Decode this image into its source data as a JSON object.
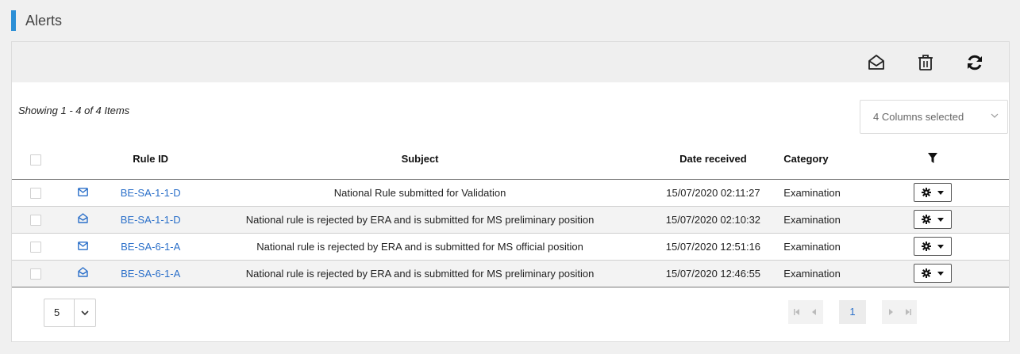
{
  "page": {
    "title": "Alerts"
  },
  "toolbar": {
    "buttons": [
      {
        "icon": "envelope-open-icon",
        "action": "mark-read"
      },
      {
        "icon": "trash-icon",
        "action": "delete"
      },
      {
        "icon": "refresh-icon",
        "action": "refresh"
      }
    ]
  },
  "summary": {
    "showing": "Showing 1 - 4 of 4 Items",
    "columns_selected": "4 Columns selected"
  },
  "table": {
    "headers": {
      "rule_id": "Rule ID",
      "subject": "Subject",
      "date_received": "Date received",
      "category": "Category"
    },
    "rows": [
      {
        "read": false,
        "rule_id": "BE-SA-1-1-D",
        "subject": "National Rule submitted for Validation",
        "date": "15/07/2020 02:11:27",
        "category": "Examination"
      },
      {
        "read": true,
        "rule_id": "BE-SA-1-1-D",
        "subject": "National rule is rejected by ERA and is submitted for MS preliminary position",
        "date": "15/07/2020 02:10:32",
        "category": "Examination"
      },
      {
        "read": false,
        "rule_id": "BE-SA-6-1-A",
        "subject": "National rule is rejected by ERA and is submitted for MS official position",
        "date": "15/07/2020 12:51:16",
        "category": "Examination"
      },
      {
        "read": true,
        "rule_id": "BE-SA-6-1-A",
        "subject": "National rule is rejected by ERA and is submitted for MS preliminary position",
        "date": "15/07/2020 12:46:55",
        "category": "Examination"
      }
    ]
  },
  "pagination": {
    "page_size": "5",
    "current_page": "1"
  },
  "colors": {
    "accent": "#2c8fd6",
    "link": "#2a6fc9"
  }
}
